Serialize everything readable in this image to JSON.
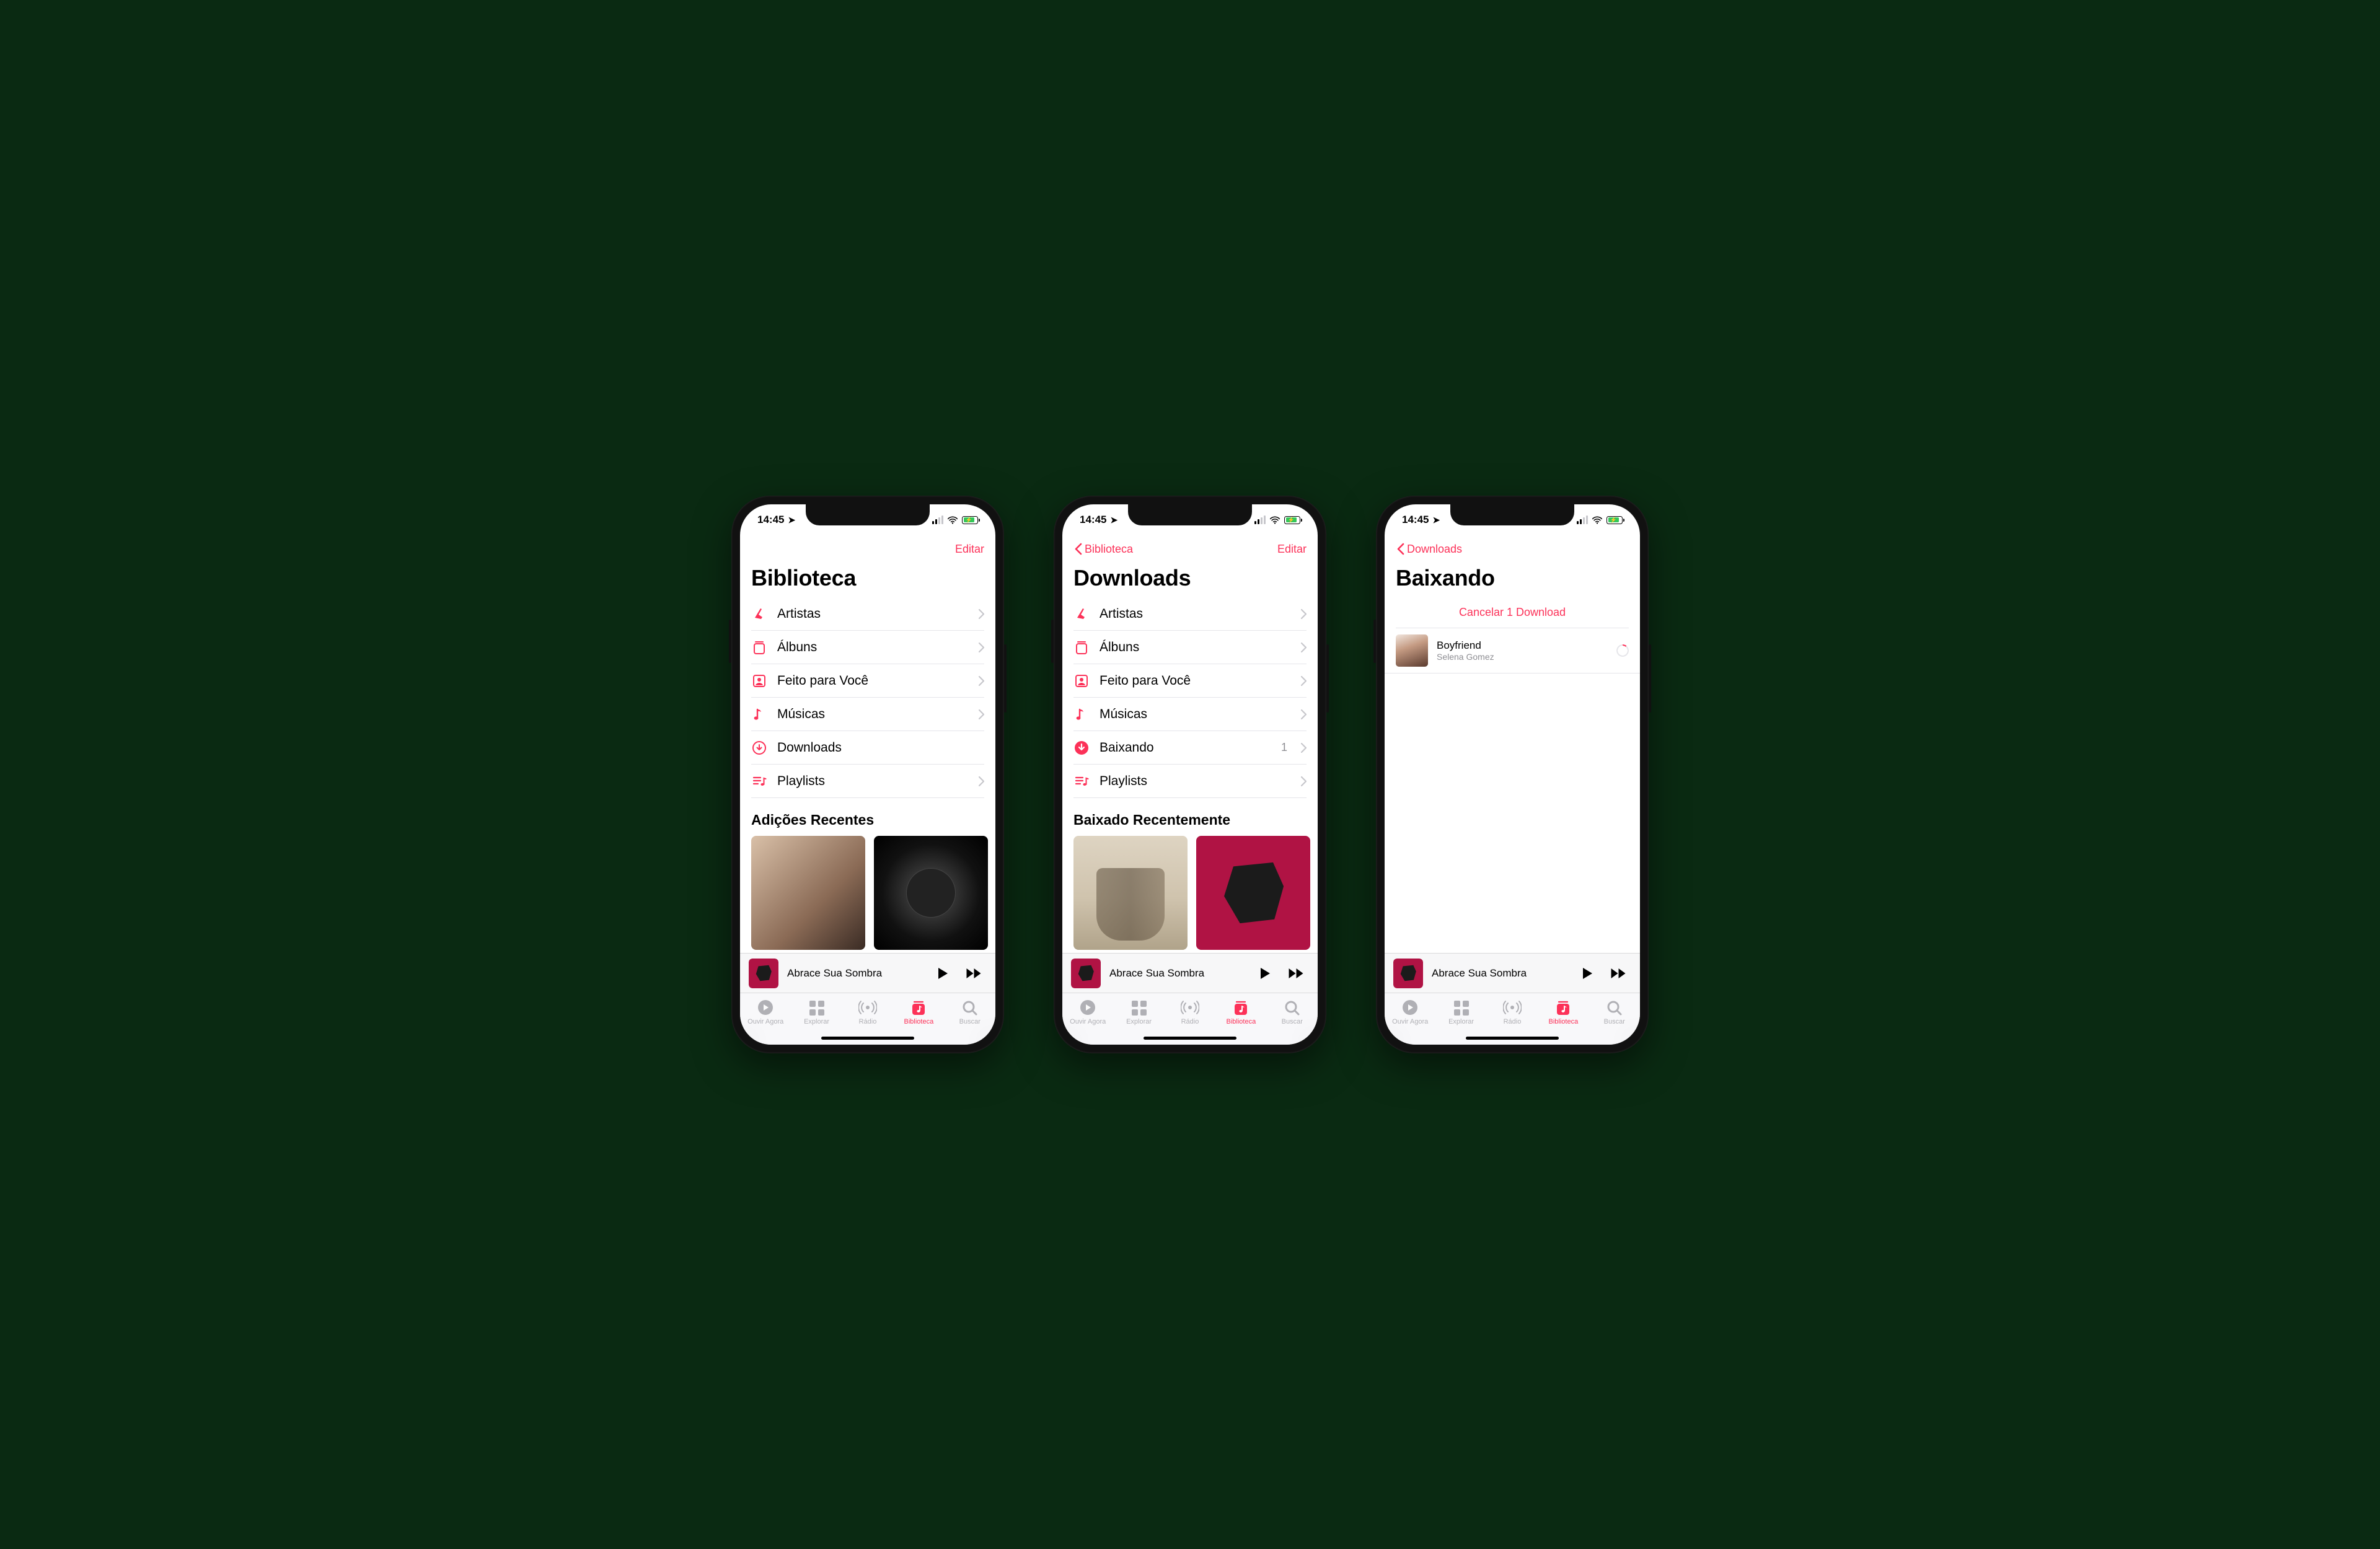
{
  "status": {
    "time": "14:45"
  },
  "screens": [
    {
      "nav": {
        "back": null,
        "edit": "Editar"
      },
      "title": "Biblioteca",
      "rows": [
        {
          "icon": "mic",
          "label": "Artistas",
          "trailing": "chev"
        },
        {
          "icon": "album",
          "label": "Álbuns",
          "trailing": "chev"
        },
        {
          "icon": "made",
          "label": "Feito para Você",
          "trailing": "chev"
        },
        {
          "icon": "note",
          "label": "Músicas",
          "trailing": "chev"
        },
        {
          "icon": "download",
          "label": "Downloads",
          "trailing": "spinner"
        },
        {
          "icon": "playlist",
          "label": "Playlists",
          "trailing": "chev"
        }
      ],
      "section": "Adições Recentes",
      "albums": [
        "face",
        "disc"
      ]
    },
    {
      "nav": {
        "back": "Biblioteca",
        "edit": "Editar"
      },
      "title": "Downloads",
      "rows": [
        {
          "icon": "mic",
          "label": "Artistas",
          "trailing": "chev"
        },
        {
          "icon": "album",
          "label": "Álbuns",
          "trailing": "chev"
        },
        {
          "icon": "made",
          "label": "Feito para Você",
          "trailing": "chev"
        },
        {
          "icon": "note",
          "label": "Músicas",
          "trailing": "chev"
        },
        {
          "icon": "downloading",
          "label": "Baixando",
          "badge": "1",
          "trailing": "chev"
        },
        {
          "icon": "playlist",
          "label": "Playlists",
          "trailing": "chev"
        }
      ],
      "section": "Baixado Recentemente",
      "albums": [
        "band",
        "rock"
      ]
    },
    {
      "nav": {
        "back": "Downloads",
        "edit": null
      },
      "title": "Baixando",
      "cancel": "Cancelar 1 Download",
      "downloads": [
        {
          "art": "selena",
          "title": "Boyfriend",
          "subtitle": "Selena Gomez"
        }
      ]
    }
  ],
  "mini_player": {
    "title": "Abrace Sua Sombra",
    "art": "rock"
  },
  "tabs": [
    {
      "icon": "play-circle",
      "label": "Ouvir Agora"
    },
    {
      "icon": "grid",
      "label": "Explorar"
    },
    {
      "icon": "radio",
      "label": "Rádio"
    },
    {
      "icon": "library",
      "label": "Biblioteca",
      "active": true
    },
    {
      "icon": "search",
      "label": "Buscar"
    }
  ]
}
